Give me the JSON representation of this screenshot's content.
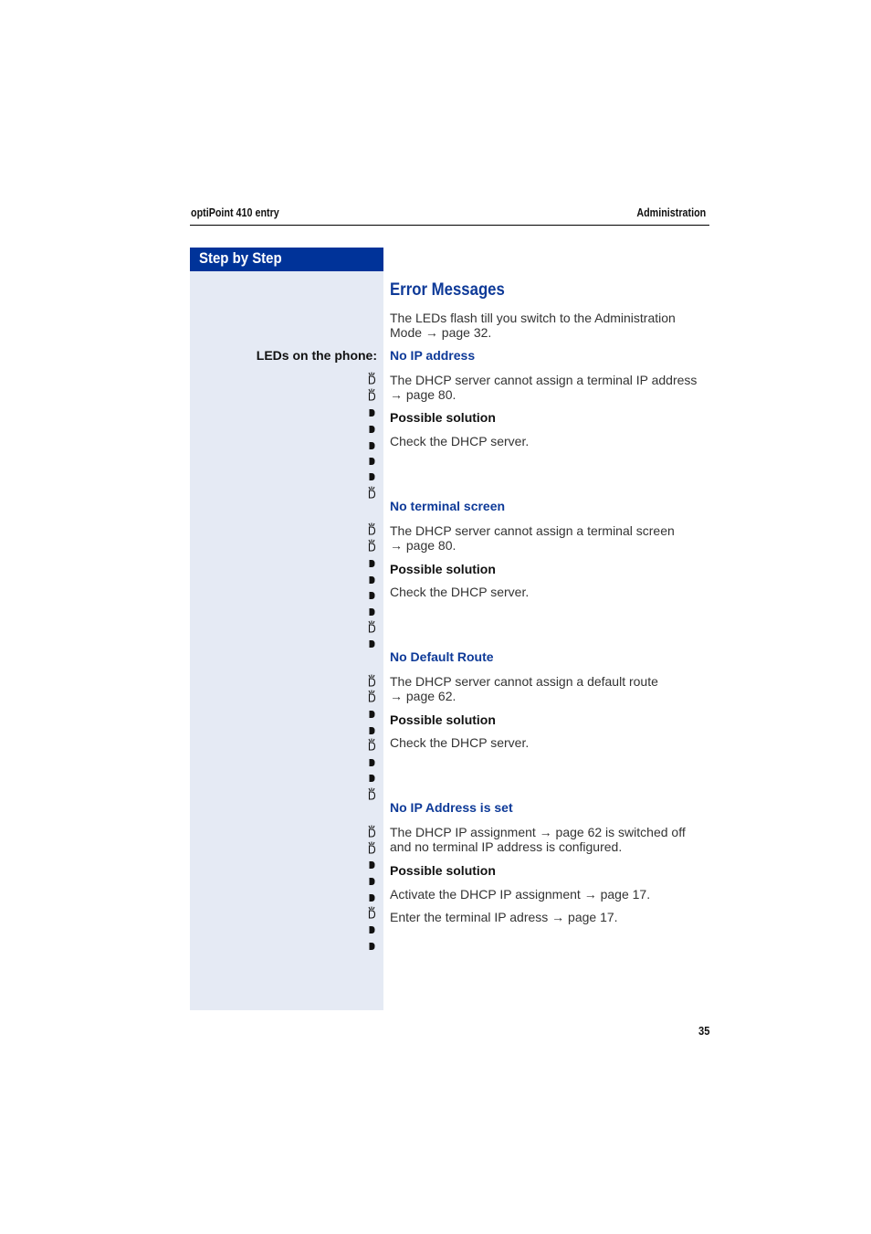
{
  "header": {
    "left": "optiPoint 410 entry",
    "right": "Administration"
  },
  "sidebar": {
    "heading": "Step by Step",
    "leds_label": "LEDs on the phone:"
  },
  "main": {
    "title": "Error Messages",
    "intro_line1": "The LEDs flash till you switch to the Administration",
    "intro_line2": "Mode → page 32.",
    "sections": [
      {
        "heading": "No IP address",
        "desc_line1": "The DHCP server cannot assign a terminal IP address",
        "desc_line2": "→ page 80.",
        "solution_label": "Possible solution",
        "solutions": [
          "Check the DHCP server."
        ],
        "leds": [
          "flashing",
          "flashing",
          "on",
          "on",
          "on",
          "on",
          "on",
          "flashing"
        ]
      },
      {
        "heading": "No terminal screen",
        "desc_line1": "The DHCP server cannot assign a terminal screen",
        "desc_line2": "→ page 80.",
        "solution_label": "Possible solution",
        "solutions": [
          "Check the DHCP server."
        ],
        "leds": [
          "flashing",
          "flashing",
          "on",
          "on",
          "on",
          "on",
          "flashing",
          "on"
        ]
      },
      {
        "heading": "No Default Route",
        "desc_line1": "The DHCP server cannot assign a default route",
        "desc_line2": "→ page 62.",
        "solution_label": "Possible solution",
        "solutions": [
          "Check the DHCP server."
        ],
        "leds": [
          "flashing",
          "flashing",
          "on",
          "on",
          "flashing",
          "on",
          "on",
          "flashing"
        ]
      },
      {
        "heading": "No IP Address is set",
        "desc_line1": "The DHCP IP assignment → page 62 is switched off",
        "desc_line2": "and no terminal IP address is configured.",
        "solution_label": "Possible solution",
        "solutions": [
          "Activate the DHCP IP assignment → page 17.",
          "Enter the terminal IP adress → page 17."
        ],
        "leds": [
          "flashing",
          "flashing",
          "on",
          "on",
          "on",
          "flashing",
          "on",
          "on"
        ]
      }
    ]
  },
  "icons": {
    "flashing": "led-flashing-icon",
    "on": "led-on-icon"
  },
  "colors": {
    "brand_blue": "#003399",
    "heading_blue": "#0e3a98",
    "sidebar_bg": "#e5eaf4"
  },
  "footer": {
    "page_number": "35"
  }
}
